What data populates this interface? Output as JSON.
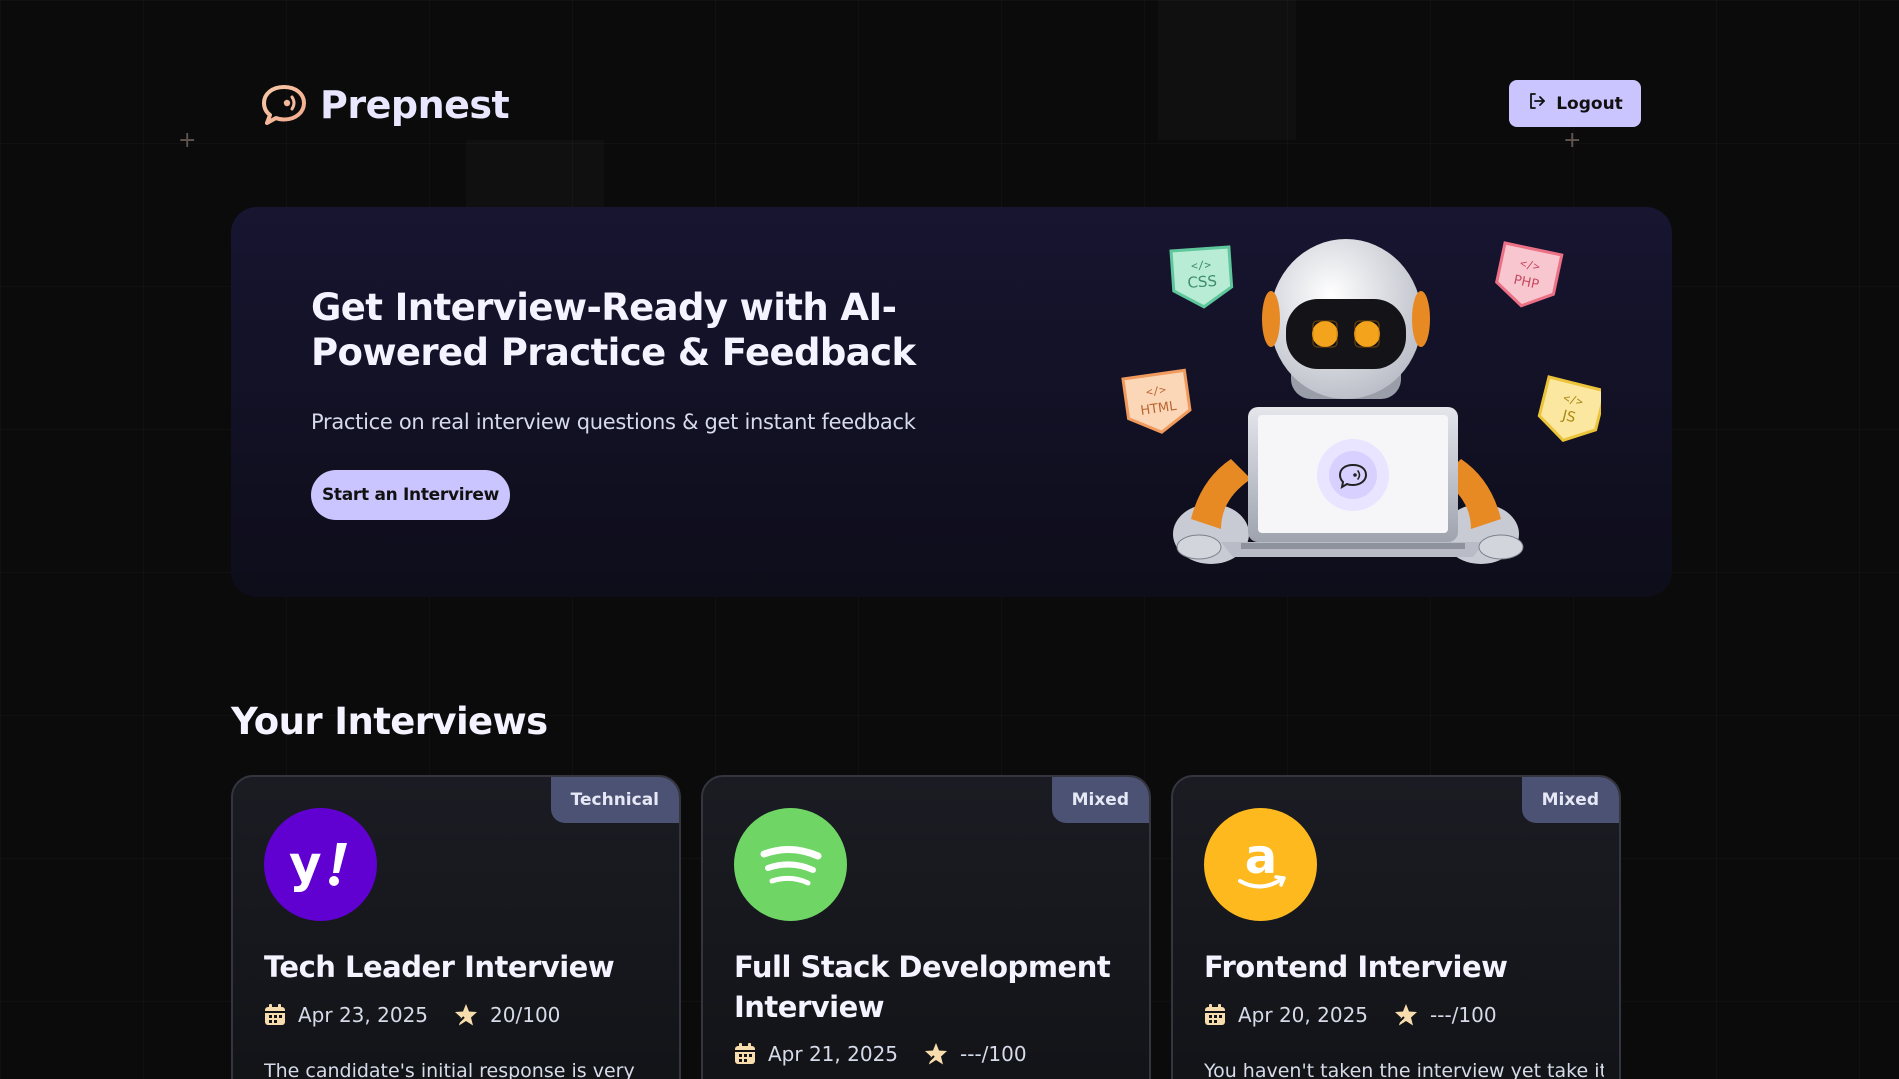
{
  "header": {
    "brand": "Prepnest",
    "logout_label": "Logout"
  },
  "hero": {
    "title": "Get Interview-Ready with AI-Powered Practice & Feedback",
    "subtitle": "Practice on real interview questions & get instant feedback",
    "cta_label": "Start an Intervirew",
    "tech_tags": [
      "CSS",
      "PHP",
      "HTML",
      "JS"
    ]
  },
  "interviews": {
    "section_title": "Your Interviews",
    "cards": [
      {
        "type": "Technical",
        "company_icon": "yahoo-logo-icon",
        "title": "Tech Leader Interview",
        "date": "Apr 23, 2025",
        "score": "20/100",
        "description": "The candidate's initial response is very"
      },
      {
        "type": "Mixed",
        "company_icon": "spotify-logo-icon",
        "title": "Full Stack Development Interview",
        "date": "Apr 21, 2025",
        "score": "---/100",
        "description": ""
      },
      {
        "type": "Mixed",
        "company_icon": "amazon-logo-icon",
        "title": "Frontend Interview",
        "date": "Apr 20, 2025",
        "score": "---/100",
        "description": "You haven't taken the interview yet take it"
      }
    ]
  },
  "colors": {
    "background": "#0b0b0c",
    "accent": "#cac5fe",
    "badge": "#4c5273",
    "yahoo": "#6001d2",
    "spotify": "#6fd565",
    "amazon": "#fdb91d"
  }
}
